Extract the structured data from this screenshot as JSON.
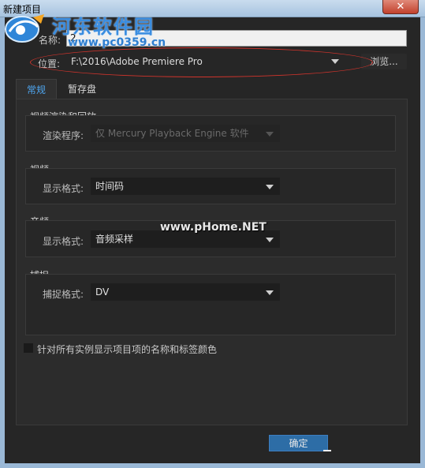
{
  "window": {
    "title": "新建项目",
    "close_symbol": "✕"
  },
  "watermark": {
    "site_name": "河东软件园",
    "site_url": "www.pc0359.cn",
    "logo": "hedong-logo-icon",
    "bottom_url": "www.pHome.NET"
  },
  "name": {
    "label": "名称:",
    "value": "2"
  },
  "location": {
    "label": "位置:",
    "value": "F:\\2016\\Adobe Premiere Pro",
    "browse_label": "浏览..."
  },
  "tabs": [
    {
      "label": "常规",
      "active": true
    },
    {
      "label": "暂存盘",
      "active": false
    }
  ],
  "sections": {
    "video_rendering": {
      "title": "视频渲染和回放",
      "renderer_label": "渲染程序:",
      "renderer_value": "仅 Mercury Playback Engine 软件"
    },
    "video": {
      "title": "视频",
      "display_format_label": "显示格式:",
      "display_format_value": "时间码"
    },
    "audio": {
      "title": "音频",
      "display_format_label": "显示格式:",
      "display_format_value": "音频采样"
    },
    "capture": {
      "title": "捕捉",
      "capture_format_label": "捕捉格式:",
      "capture_format_value": "DV"
    }
  },
  "checkbox": {
    "label": "针对所有实例显示项目项的名称和标签颜色",
    "checked": false
  },
  "ok_button": "确定",
  "colors": {
    "accent": "#4ea6f0",
    "background": "#262626",
    "ok_button": "#2d6da6",
    "annotation_ellipse": "#d0342c"
  }
}
